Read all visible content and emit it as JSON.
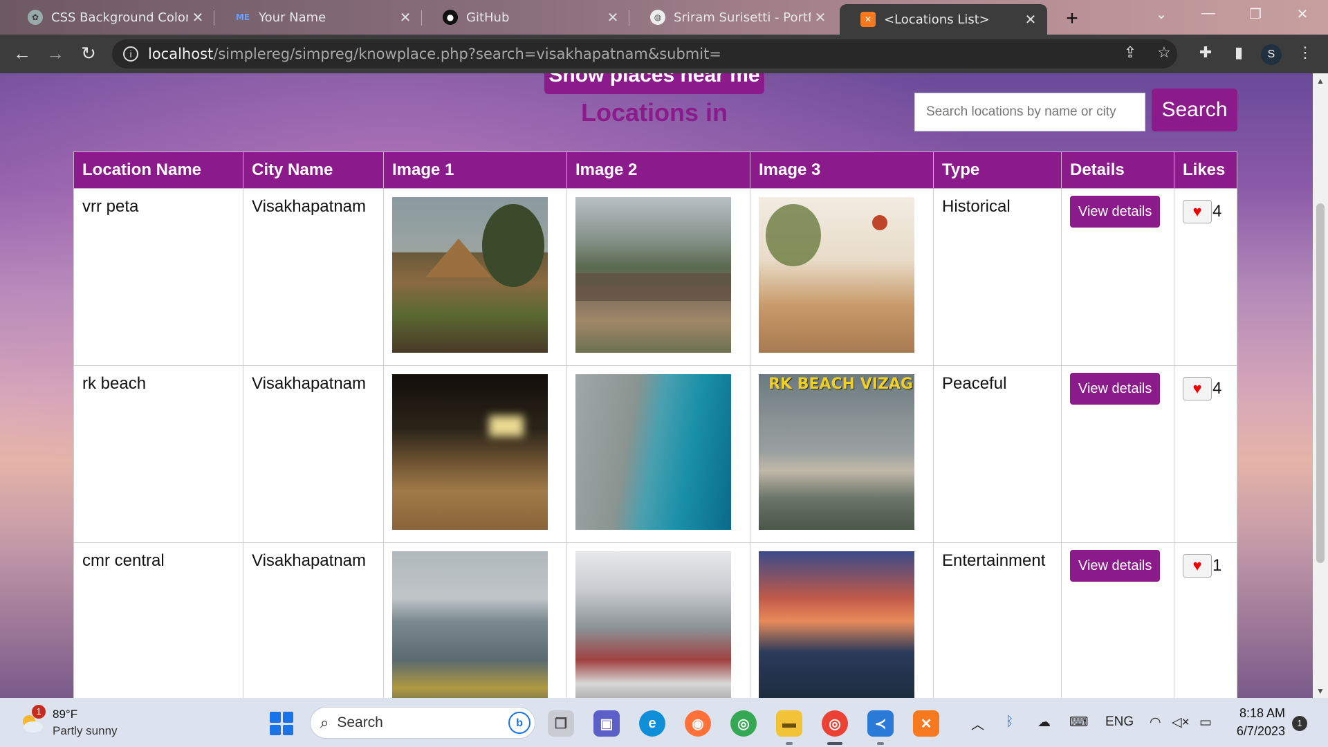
{
  "browser": {
    "tabs": [
      {
        "title": "CSS Background Color Tra",
        "icon": "chatgpt-icon"
      },
      {
        "title": "Your Name",
        "icon": "me-icon",
        "icon_text": "ME"
      },
      {
        "title": "GitHub",
        "icon": "github-icon"
      },
      {
        "title": "Sriram Surisetti - Portfolio",
        "icon": "globe-icon"
      },
      {
        "title": "<Locations List>",
        "icon": "xampp-icon",
        "active": true
      }
    ],
    "url_host": "localhost",
    "url_path": "/simplereg/simpreg/knowplace.php?search=visakhapatnam&submit=",
    "profile_initial": "S"
  },
  "page": {
    "show_places_label": "Show places near me",
    "heading": "Locations in",
    "search_placeholder": "Search locations by name or city",
    "search_button": "Search",
    "columns": [
      "Location Name",
      "City Name",
      "Image 1",
      "Image 2",
      "Image 3",
      "Type",
      "Details",
      "Likes"
    ],
    "view_details_label": "View details",
    "rows": [
      {
        "name": "vrr peta",
        "city": "Visakhapatnam",
        "type": "Historical",
        "likes": "4",
        "images": [
          "village-hut-photo",
          "hillside-village-photo",
          "village-painting"
        ]
      },
      {
        "name": "rk beach",
        "city": "Visakhapatnam",
        "type": "Peaceful",
        "likes": "4",
        "images": [
          "night-beach-photo",
          "aerial-coastline-photo",
          "rk-beach-vizag-photo"
        ],
        "image_caption": "RK BEACH VIZAG"
      },
      {
        "name": "cmr central",
        "city": "Visakhapatnam",
        "type": "Entertainment",
        "likes": "1",
        "images": [
          "mall-front-photo",
          "mall-parking-photo",
          "mall-sunset-photo"
        ]
      }
    ]
  },
  "taskbar": {
    "weather_badge": "1",
    "weather_temp": "89°F",
    "weather_desc": "Partly sunny",
    "search_label": "Search",
    "language": "ENG",
    "time": "8:18 AM",
    "date": "6/7/2023",
    "notification_count": "1"
  },
  "colors": {
    "accent": "#8b1a8b",
    "like_heart": "#e00000"
  }
}
